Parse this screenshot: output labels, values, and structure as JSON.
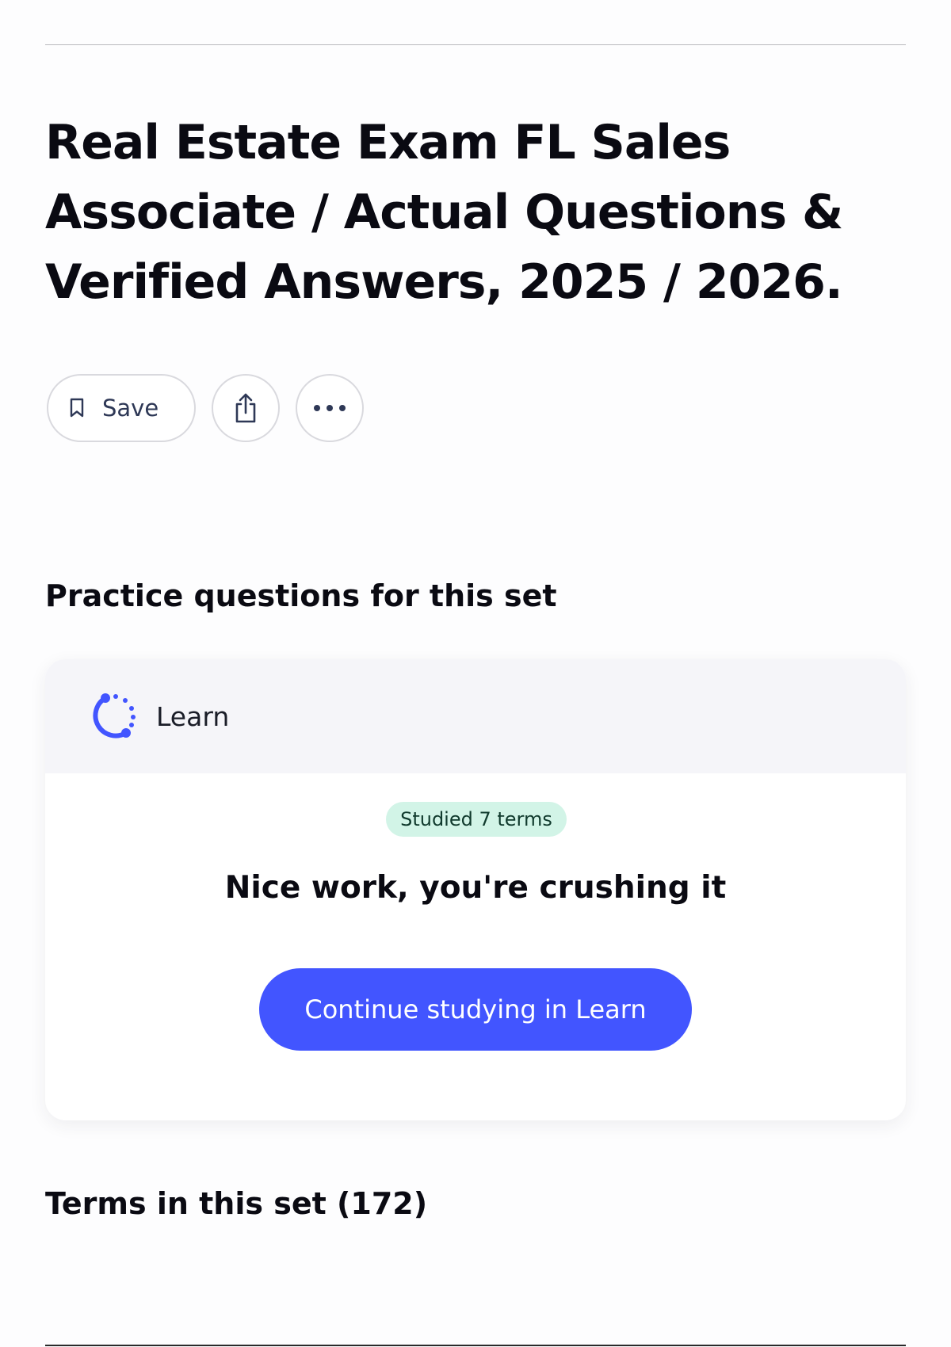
{
  "header": {
    "title": "Real Estate Exam FL Sales Associate / Actual Questions & Verified Answers, 2025 / 2026."
  },
  "actions": {
    "save_label": "Save",
    "save_icon": "bookmark-icon",
    "share_icon": "share-icon",
    "more_icon": "more-options-icon"
  },
  "practice": {
    "heading": "Practice questions for this set",
    "card": {
      "mode_label": "Learn",
      "mode_icon": "learn-icon",
      "badge": "Studied 7 terms",
      "message": "Nice work, you're crushing it",
      "cta_label": "Continue studying in Learn"
    }
  },
  "terms": {
    "heading": "Terms in this set (172)"
  },
  "colors": {
    "accent": "#4255ff",
    "badge_background": "#d2f4e7",
    "card_header_background": "#f5f5f9"
  }
}
